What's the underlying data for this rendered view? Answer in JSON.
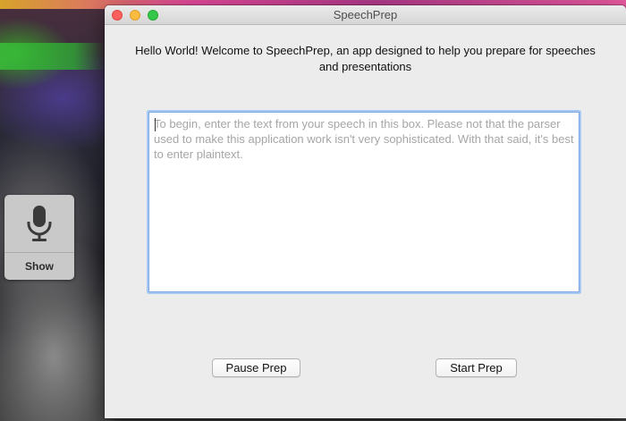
{
  "window": {
    "title": "SpeechPrep",
    "controls": [
      "close",
      "minimize",
      "zoom"
    ]
  },
  "intro": {
    "text": "Hello World! Welcome to SpeechPrep, an app designed to help you prepare for speeches and presentations"
  },
  "speech_input": {
    "value": "",
    "placeholder": "To begin, enter the text from your speech in this box. Please not that the parser used to make this application work isn't very sophisticated. With that said, it's best to enter plaintext."
  },
  "buttons": {
    "pause_label": "Pause Prep",
    "start_label": "Start Prep"
  },
  "dictation": {
    "icon": "microphone-icon",
    "label": "Show"
  },
  "colors": {
    "close": "#fc605c",
    "minimize": "#fdbc40",
    "zoom": "#34c84a",
    "focus_ring": "#a6c8f2"
  }
}
